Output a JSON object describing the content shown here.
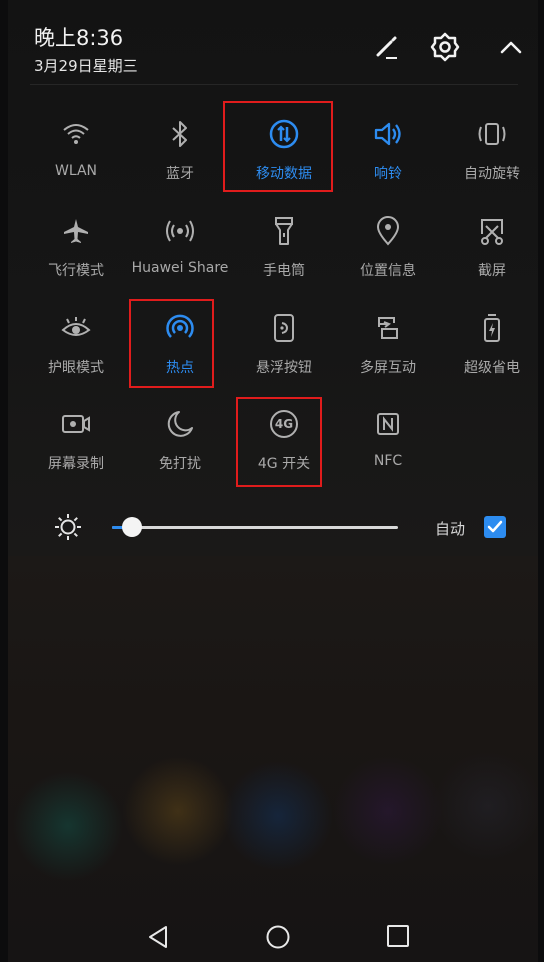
{
  "status": {
    "time": "晚上8:36",
    "date": "3月29日星期三"
  },
  "header_icons": [
    "edit-icon",
    "settings-icon",
    "collapse-icon"
  ],
  "toggles": [
    {
      "label": "WLAN",
      "icon": "wifi-icon",
      "active": false
    },
    {
      "label": "蓝牙",
      "icon": "bluetooth-icon",
      "active": false
    },
    {
      "label": "移动数据",
      "icon": "mobile-data-icon",
      "active": true,
      "highlighted": true
    },
    {
      "label": "响铃",
      "icon": "ring-icon",
      "active": true
    },
    {
      "label": "自动旋转",
      "icon": "auto-rotate-icon",
      "active": false
    },
    {
      "label": "飞行模式",
      "icon": "airplane-icon",
      "active": false
    },
    {
      "label": "Huawei Share",
      "icon": "huawei-share-icon",
      "active": false
    },
    {
      "label": "手电筒",
      "icon": "flashlight-icon",
      "active": false
    },
    {
      "label": "位置信息",
      "icon": "location-icon",
      "active": false
    },
    {
      "label": "截屏",
      "icon": "screenshot-icon",
      "active": false
    },
    {
      "label": "护眼模式",
      "icon": "eye-comfort-icon",
      "active": false
    },
    {
      "label": "热点",
      "icon": "hotspot-icon",
      "active": true,
      "highlighted": true
    },
    {
      "label": "悬浮按钮",
      "icon": "floating-button-icon",
      "active": false
    },
    {
      "label": "多屏互动",
      "icon": "multi-screen-icon",
      "active": false
    },
    {
      "label": "超级省电",
      "icon": "ultra-power-saving-icon",
      "active": false
    },
    {
      "label": "屏幕录制",
      "icon": "screen-record-icon",
      "active": false
    },
    {
      "label": "免打扰",
      "icon": "do-not-disturb-icon",
      "active": false
    },
    {
      "label": "4G 开关",
      "icon": "4g-switch-icon",
      "icon_text": "4G",
      "active": false,
      "highlighted": true
    },
    {
      "label": "NFC",
      "icon": "nfc-icon",
      "active": false
    }
  ],
  "brightness": {
    "level": 0.07,
    "auto_label": "自动",
    "auto_checked": true
  },
  "nav": [
    "back-icon",
    "home-icon",
    "recents-icon"
  ],
  "colors": {
    "accent": "#2d8cf0",
    "highlight_box": "#e01c1c",
    "label_inactive": "#a9a9a9",
    "icon_inactive": "#b0b0b0"
  }
}
